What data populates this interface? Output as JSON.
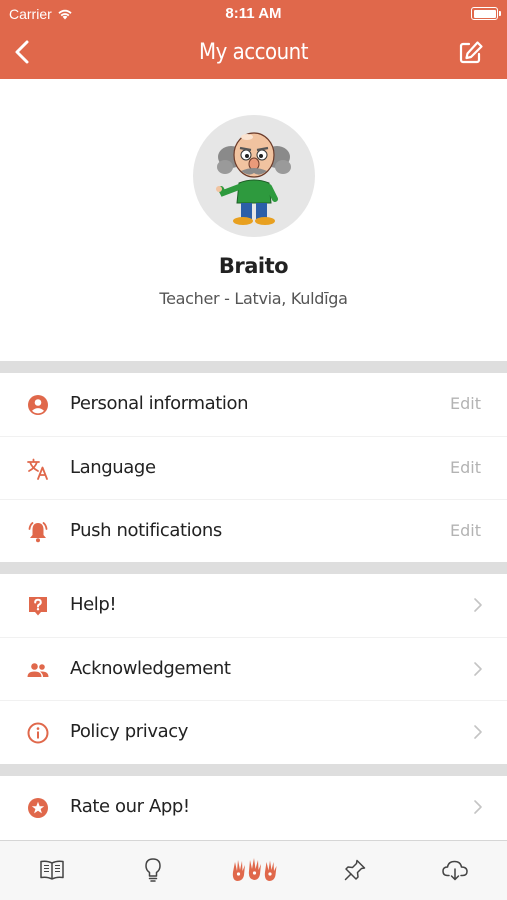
{
  "status_bar": {
    "carrier": "Carrier",
    "time": "8:11 AM"
  },
  "nav": {
    "title": "My account",
    "back_icon": "chevron-left-icon",
    "edit_icon": "edit-icon"
  },
  "colors": {
    "accent": "#e0684b",
    "divider": "#dedede",
    "muted": "#b3b3b3"
  },
  "profile": {
    "name": "Braito",
    "subtitle": "Teacher - Latvia, Kuldīga"
  },
  "settings": [
    {
      "icon": "person-icon",
      "label": "Personal information",
      "action": "Edit"
    },
    {
      "icon": "translate-icon",
      "label": "Language",
      "action": "Edit"
    },
    {
      "icon": "bell-icon",
      "label": "Push notifications",
      "action": "Edit"
    }
  ],
  "support": [
    {
      "icon": "help-icon",
      "label": "Help!"
    },
    {
      "icon": "people-icon",
      "label": "Acknowledgement"
    },
    {
      "icon": "info-icon",
      "label": "Policy privacy"
    }
  ],
  "rate": {
    "icon": "star-icon",
    "label": "Rate our App!"
  },
  "tabbar": [
    "book-icon",
    "lightbulb-icon",
    "hands-logo-icon",
    "pin-icon",
    "cloud-download-icon"
  ]
}
